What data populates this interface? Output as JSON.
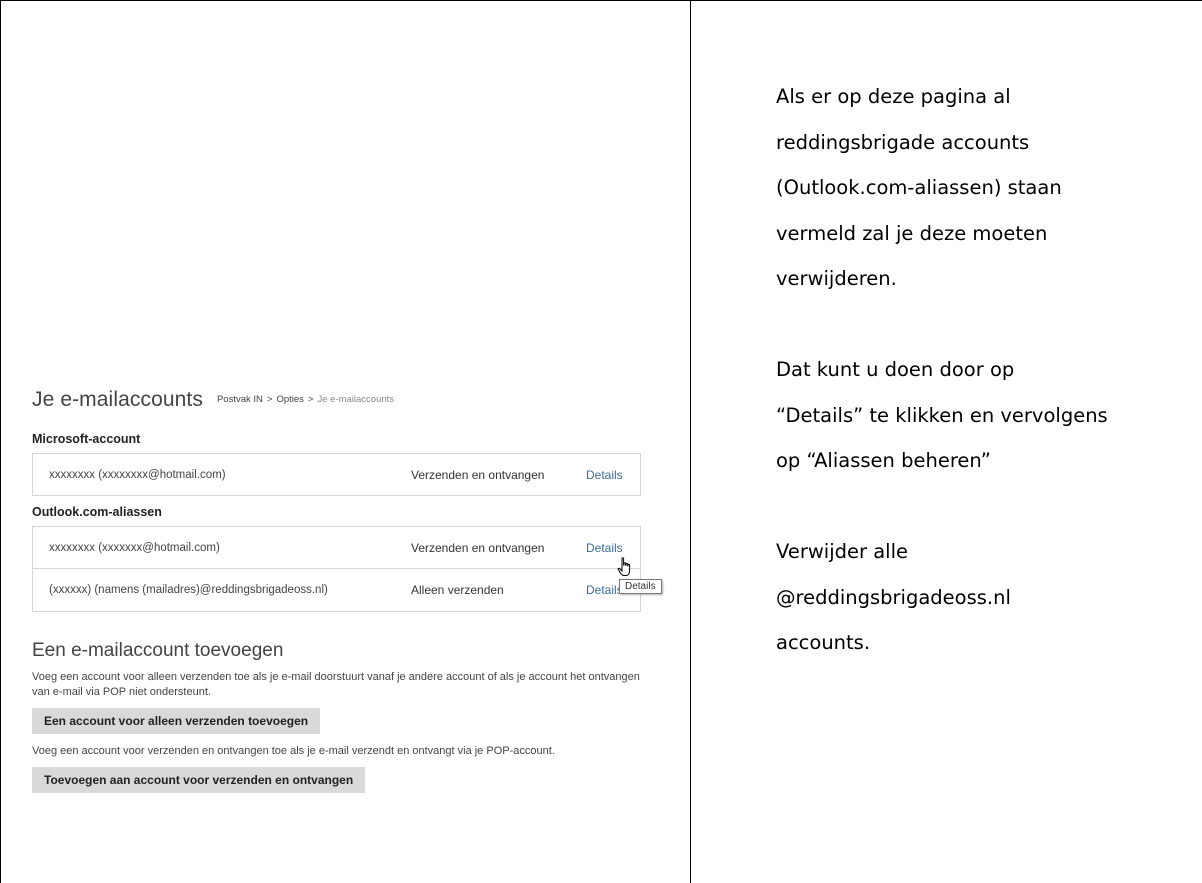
{
  "instructions": {
    "paragraph1": [
      "Als er op deze pagina al",
      "reddingsbrigade accounts",
      "(Outlook.com-aliassen) staan",
      "vermeld zal je deze moeten",
      "verwijderen."
    ],
    "paragraph2": [
      "Dat kunt u doen door op",
      "“Details” te klikken en vervolgens",
      "op “Aliassen beheren”"
    ],
    "paragraph3": [
      "Verwijder alle",
      "@reddingsbrigadeoss.nl",
      "accounts."
    ]
  },
  "header": {
    "title": "Je e-mailaccounts",
    "breadcrumb": [
      "Postvak IN",
      "Opties",
      "Je e-mailaccounts"
    ],
    "separator": ">"
  },
  "microsoft_account": {
    "section_title": "Microsoft-account",
    "rows": [
      {
        "address": "xxxxxxxx (xxxxxxxx@hotmail.com)",
        "status": "Verzenden en ontvangen",
        "action": "Details"
      }
    ]
  },
  "aliases": {
    "section_title": "Outlook.com-aliassen",
    "rows": [
      {
        "address": "xxxxxxxx (xxxxxxx@hotmail.com)",
        "status": "Verzenden en ontvangen",
        "action": "Details"
      },
      {
        "address": "(xxxxxx) (namens (mailadres)@reddingsbrigadeoss.nl)",
        "status": "Alleen verzenden",
        "action": "Details"
      }
    ],
    "tooltip": "Details"
  },
  "add_account": {
    "title": "Een e-mailaccount toevoegen",
    "send_only_description": "Voeg een account voor alleen verzenden toe als je e-mail doorstuurt vanaf je andere account of als je account het ontvangen van e-mail via POP niet ondersteunt.",
    "send_only_button": "Een account voor alleen verzenden toevoegen",
    "send_receive_description": "Voeg een account voor verzenden en ontvangen toe als je e-mail verzendt en ontvangt via je POP-account.",
    "send_receive_button": "Toevoegen aan account voor verzenden en ontvangen"
  },
  "colors": {
    "link": "#3b6d9b",
    "button_bg": "#d9d9d9",
    "border": "#d4d4d4"
  },
  "icons": {
    "cursor": "hand-pointer-icon"
  }
}
